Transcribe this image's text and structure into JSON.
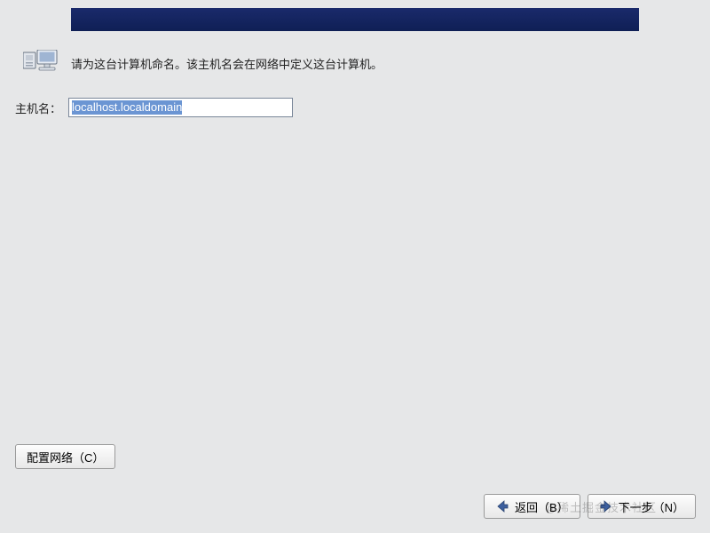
{
  "header": {},
  "instruction": {
    "text": "请为这台计算机命名。该主机名会在网络中定义这台计算机。"
  },
  "form": {
    "hostname_label": "主机名：",
    "hostname_value": "localhost.localdomain"
  },
  "buttons": {
    "configure_network": "配置网络（C）",
    "back": "返回（B）",
    "next": "下一步（N）"
  },
  "watermark": "@稀土掘金技术社区"
}
